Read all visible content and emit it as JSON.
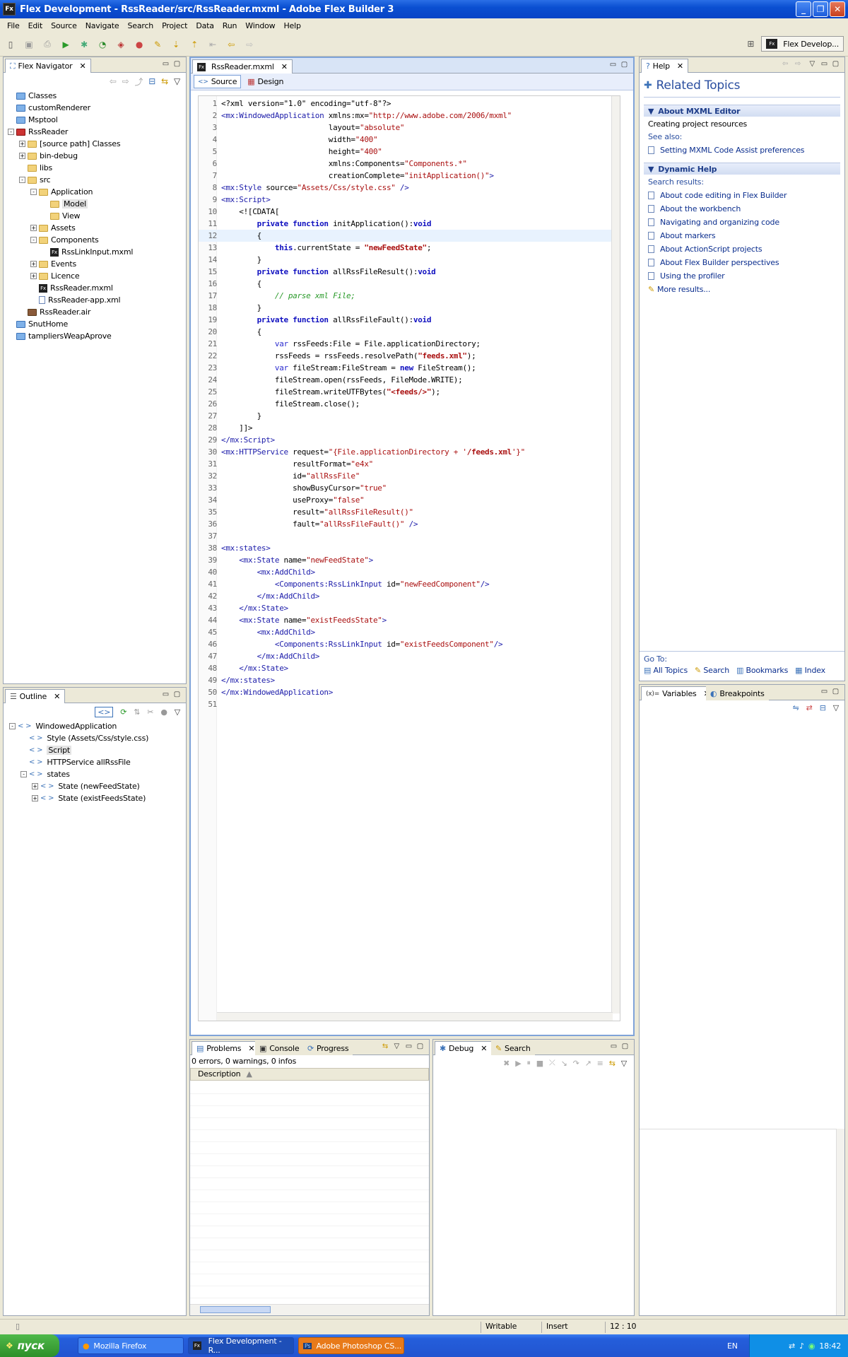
{
  "window": {
    "title": "Flex Development - RssReader/src/RssReader.mxml - Adobe Flex Builder 3",
    "app_icon": "Fx"
  },
  "menu": [
    "File",
    "Edit",
    "Source",
    "Navigate",
    "Search",
    "Project",
    "Data",
    "Run",
    "Window",
    "Help"
  ],
  "perspective": {
    "label": "Flex Develop...",
    "icon": "Fx"
  },
  "navigator": {
    "tab": "Flex Navigator",
    "items": [
      {
        "label": "Classes",
        "indent": 0,
        "kind": "project",
        "pm": ""
      },
      {
        "label": "customRenderer",
        "indent": 0,
        "kind": "project",
        "pm": ""
      },
      {
        "label": "Msptool",
        "indent": 0,
        "kind": "project",
        "pm": ""
      },
      {
        "label": "RssReader",
        "indent": 0,
        "kind": "fxproject",
        "pm": "-"
      },
      {
        "label": "[source path] Classes",
        "indent": 1,
        "kind": "folder",
        "pm": "+"
      },
      {
        "label": "bin-debug",
        "indent": 1,
        "kind": "folder",
        "pm": "+"
      },
      {
        "label": "libs",
        "indent": 1,
        "kind": "folder",
        "pm": ""
      },
      {
        "label": "src",
        "indent": 1,
        "kind": "folder",
        "pm": "-"
      },
      {
        "label": "Application",
        "indent": 2,
        "kind": "folder",
        "pm": "-"
      },
      {
        "label": "Model",
        "indent": 3,
        "kind": "folder",
        "pm": "",
        "selected": true
      },
      {
        "label": "View",
        "indent": 3,
        "kind": "folder",
        "pm": ""
      },
      {
        "label": "Assets",
        "indent": 2,
        "kind": "folder",
        "pm": "+"
      },
      {
        "label": "Components",
        "indent": 2,
        "kind": "folder",
        "pm": "-"
      },
      {
        "label": "RssLinkInput.mxml",
        "indent": 3,
        "kind": "fx",
        "pm": ""
      },
      {
        "label": "Events",
        "indent": 2,
        "kind": "folder",
        "pm": "+"
      },
      {
        "label": "Licence",
        "indent": 2,
        "kind": "folder",
        "pm": "+"
      },
      {
        "label": "RssReader.mxml",
        "indent": 2,
        "kind": "fx",
        "pm": ""
      },
      {
        "label": "RssReader-app.xml",
        "indent": 2,
        "kind": "file",
        "pm": ""
      },
      {
        "label": "RssReader.air",
        "indent": 1,
        "kind": "air",
        "pm": ""
      },
      {
        "label": "SnutHome",
        "indent": 0,
        "kind": "project",
        "pm": ""
      },
      {
        "label": "tampliersWeapAprove",
        "indent": 0,
        "kind": "project",
        "pm": ""
      }
    ]
  },
  "outline": {
    "tab": "Outline",
    "items": [
      {
        "label": "WindowedApplication",
        "indent": 0,
        "pm": "-"
      },
      {
        "label": "Style (Assets/Css/style.css)",
        "indent": 1,
        "pm": ""
      },
      {
        "label": "Script",
        "indent": 1,
        "pm": "",
        "selected": true
      },
      {
        "label": "HTTPService allRssFile",
        "indent": 1,
        "pm": ""
      },
      {
        "label": "states",
        "indent": 1,
        "pm": "-"
      },
      {
        "label": "State (newFeedState)",
        "indent": 2,
        "pm": "+"
      },
      {
        "label": "State (existFeedsState)",
        "indent": 2,
        "pm": "+"
      }
    ]
  },
  "editor": {
    "tab": "RssReader.mxml",
    "source_label": "Source",
    "design_label": "Design",
    "current_line": 12,
    "lines": [
      [
        [
          "x",
          "<?xml version=\"1.0\" encoding=\"utf-8\"?>"
        ]
      ],
      [
        [
          "t",
          "<mx:WindowedApplication"
        ],
        [
          "x",
          " xmlns:mx="
        ],
        [
          "s",
          "\"http://www.adobe.com/2006/mxml\""
        ]
      ],
      [
        [
          "x",
          "                        layout="
        ],
        [
          "s",
          "\"absolute\""
        ]
      ],
      [
        [
          "x",
          "                        width="
        ],
        [
          "s",
          "\"400\""
        ]
      ],
      [
        [
          "x",
          "                        height="
        ],
        [
          "s",
          "\"400\""
        ]
      ],
      [
        [
          "x",
          "                        xmlns:Components="
        ],
        [
          "s",
          "\"Components.*\""
        ]
      ],
      [
        [
          "x",
          "                        creationComplete="
        ],
        [
          "s",
          "\"initApplication()\""
        ],
        [
          "t",
          ">"
        ]
      ],
      [
        [
          "t",
          "<mx:Style"
        ],
        [
          "x",
          " source="
        ],
        [
          "s",
          "\"Assets/Css/style.css\""
        ],
        [
          "t",
          " />"
        ]
      ],
      [
        [
          "t",
          "<mx:Script>"
        ]
      ],
      [
        [
          "x",
          "    <![CDATA["
        ]
      ],
      [
        [
          "x",
          "        "
        ],
        [
          "k",
          "private function"
        ],
        [
          "x",
          " initApplication():"
        ],
        [
          "k",
          "void"
        ]
      ],
      [
        [
          "x",
          "        {"
        ]
      ],
      [
        [
          "x",
          "            "
        ],
        [
          "k",
          "this"
        ],
        [
          "x",
          ".currentState = "
        ],
        [
          "b",
          "\"newFeedState\""
        ],
        [
          "x",
          ";"
        ]
      ],
      [
        [
          "x",
          "        }"
        ]
      ],
      [
        [
          "x",
          "        "
        ],
        [
          "k",
          "private function"
        ],
        [
          "x",
          " allRssFileResult():"
        ],
        [
          "k",
          "void"
        ]
      ],
      [
        [
          "x",
          "        {"
        ]
      ],
      [
        [
          "x",
          "            "
        ],
        [
          "c",
          "// parse xml File;"
        ]
      ],
      [
        [
          "x",
          "        }"
        ]
      ],
      [
        [
          "x",
          "        "
        ],
        [
          "k",
          "private function"
        ],
        [
          "x",
          " allRssFileFault():"
        ],
        [
          "k",
          "void"
        ]
      ],
      [
        [
          "x",
          "        {"
        ]
      ],
      [
        [
          "x",
          "            "
        ],
        [
          "v",
          "var"
        ],
        [
          "x",
          " rssFeeds:File = File.applicationDirectory;"
        ]
      ],
      [
        [
          "x",
          "            rssFeeds = rssFeeds.resolvePath("
        ],
        [
          "b",
          "\"feeds.xml\""
        ],
        [
          "x",
          ");"
        ]
      ],
      [
        [
          "x",
          "            "
        ],
        [
          "v",
          "var"
        ],
        [
          "x",
          " fileStream:FileStream = "
        ],
        [
          "k",
          "new"
        ],
        [
          "x",
          " FileStream();"
        ]
      ],
      [
        [
          "x",
          "            fileStream.open(rssFeeds, FileMode.WRITE);"
        ]
      ],
      [
        [
          "x",
          "            fileStream.writeUTFBytes("
        ],
        [
          "b",
          "\"<feeds/>\""
        ],
        [
          "x",
          ");"
        ]
      ],
      [
        [
          "x",
          "            fileStream.close();"
        ]
      ],
      [
        [
          "x",
          "        }"
        ]
      ],
      [
        [
          "x",
          "    ]]>"
        ]
      ],
      [
        [
          "t",
          "</mx:Script>"
        ]
      ],
      [
        [
          "t",
          "<mx:HTTPService"
        ],
        [
          "x",
          " request="
        ],
        [
          "s",
          "\"{File.applicationDirectory + '"
        ],
        [
          "b",
          "/feeds.xml"
        ],
        [
          "s",
          "'}\""
        ]
      ],
      [
        [
          "x",
          "                resultFormat="
        ],
        [
          "s",
          "\"e4x\""
        ]
      ],
      [
        [
          "x",
          "                id="
        ],
        [
          "s",
          "\"allRssFile\""
        ]
      ],
      [
        [
          "x",
          "                showBusyCursor="
        ],
        [
          "s",
          "\"true\""
        ]
      ],
      [
        [
          "x",
          "                useProxy="
        ],
        [
          "s",
          "\"false\""
        ]
      ],
      [
        [
          "x",
          "                result="
        ],
        [
          "s",
          "\"allRssFileResult()\""
        ]
      ],
      [
        [
          "x",
          "                fault="
        ],
        [
          "s",
          "\"allRssFileFault()\""
        ],
        [
          "t",
          " />"
        ]
      ],
      [
        [
          "x",
          ""
        ]
      ],
      [
        [
          "t",
          "<mx:states>"
        ]
      ],
      [
        [
          "x",
          "    "
        ],
        [
          "t",
          "<mx:State"
        ],
        [
          "x",
          " name="
        ],
        [
          "s",
          "\"newFeedState\""
        ],
        [
          "t",
          ">"
        ]
      ],
      [
        [
          "x",
          "        "
        ],
        [
          "t",
          "<mx:AddChild>"
        ]
      ],
      [
        [
          "x",
          "            "
        ],
        [
          "t",
          "<Components:RssLinkInput"
        ],
        [
          "x",
          " id="
        ],
        [
          "s",
          "\"newFeedComponent\""
        ],
        [
          "t",
          "/>"
        ]
      ],
      [
        [
          "x",
          "        "
        ],
        [
          "t",
          "</mx:AddChild>"
        ]
      ],
      [
        [
          "x",
          "    "
        ],
        [
          "t",
          "</mx:State>"
        ]
      ],
      [
        [
          "x",
          "    "
        ],
        [
          "t",
          "<mx:State"
        ],
        [
          "x",
          " name="
        ],
        [
          "s",
          "\"existFeedsState\""
        ],
        [
          "t",
          ">"
        ]
      ],
      [
        [
          "x",
          "        "
        ],
        [
          "t",
          "<mx:AddChild>"
        ]
      ],
      [
        [
          "x",
          "            "
        ],
        [
          "t",
          "<Components:RssLinkInput"
        ],
        [
          "x",
          " id="
        ],
        [
          "s",
          "\"existFeedsComponent\""
        ],
        [
          "t",
          "/>"
        ]
      ],
      [
        [
          "x",
          "        "
        ],
        [
          "t",
          "</mx:AddChild>"
        ]
      ],
      [
        [
          "x",
          "    "
        ],
        [
          "t",
          "</mx:State>"
        ]
      ],
      [
        [
          "t",
          "</mx:states>"
        ]
      ],
      [
        [
          "t",
          "</mx:WindowedApplication>"
        ]
      ],
      [
        [
          "x",
          ""
        ]
      ]
    ]
  },
  "help": {
    "tab": "Help",
    "title": "Related Topics",
    "section1": "About MXML Editor",
    "item1": "Creating project resources",
    "see_also": "See also:",
    "see_also_link": "Setting MXML Code Assist preferences",
    "section2": "Dynamic Help",
    "search_results": "Search results:",
    "links": [
      "About code editing in Flex Builder",
      "About the workbench",
      "Navigating and organizing code",
      "About markers",
      "About ActionScript projects",
      "About Flex Builder perspectives",
      "Using the profiler"
    ],
    "more": "More results...",
    "goto": "Go To:",
    "nav": [
      "All Topics",
      "Search",
      "Bookmarks",
      "Index"
    ]
  },
  "debugview": {
    "tabs": [
      "Variables",
      "Breakpoints"
    ]
  },
  "problems": {
    "tabs": [
      "Problems",
      "Console",
      "Progress"
    ],
    "summary": "0 errors, 0 warnings, 0 infos",
    "column": "Description"
  },
  "debug": {
    "tabs": [
      "Debug",
      "Search"
    ]
  },
  "status": {
    "writable": "Writable",
    "insert": "Insert",
    "position": "12 : 10"
  },
  "taskbar": {
    "start": "пуск",
    "tasks": [
      "Mozilla Firefox",
      "Flex Development - R...",
      "Adobe Photoshop CS..."
    ],
    "lang": "EN",
    "time": "18:42"
  }
}
